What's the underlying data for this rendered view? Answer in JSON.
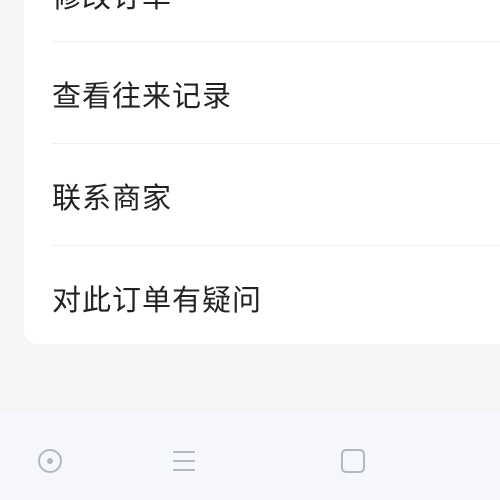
{
  "menu": {
    "items": [
      {
        "label": "修改订单"
      },
      {
        "label": "查看往来记录"
      },
      {
        "label": "联系商家"
      },
      {
        "label": "对此订单有疑问"
      }
    ]
  },
  "navbar": {
    "icons": [
      "home-circle-icon",
      "menu-lines-icon",
      "square-icon"
    ]
  },
  "colors": {
    "background": "#f5f5f5",
    "card": "#ffffff",
    "text": "#222222",
    "navbar": "#f6f7fc",
    "nav_icon": "#b4b7c2"
  }
}
